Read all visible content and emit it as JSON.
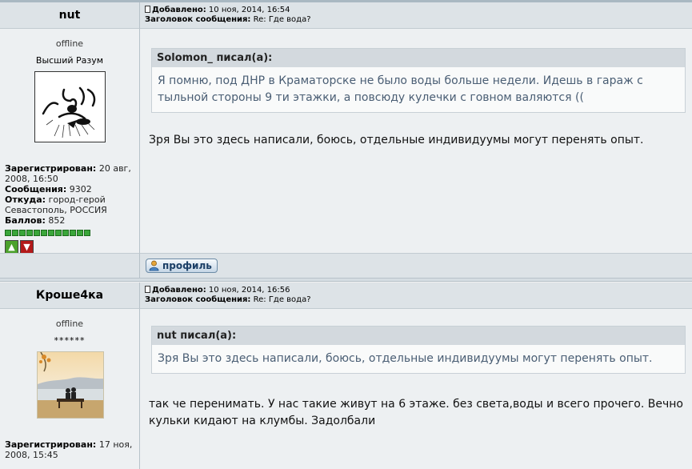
{
  "posts": [
    {
      "author": "nut",
      "status": "offline",
      "rank": "Высший Разум",
      "posted_label": "Добавлено:",
      "posted_at": "10 ноя, 2014, 16:54",
      "subject_label": "Заголовок сообщения:",
      "subject": "Re: Где вода?",
      "registered_label": "Зарегистрирован:",
      "registered": "20 авг, 2008, 16:50",
      "messages_label": "Сообщения:",
      "messages": "9302",
      "from_label": "Откуда:",
      "from": "город-герой Севастополь, РОССИЯ",
      "points_label": "Баллов:",
      "points": "852",
      "quote_author": "Solomon_ писал(а):",
      "quote_text": "Я помню, под ДНР в Краматорске не было воды больше недели. Идешь в гараж с тыльной стороны 9 ти этажки, а повсюду кулечки с говном валяются ((",
      "message": "Зря Вы это здесь написали, боюсь, отдельные индивидуумы могут перенять опыт.",
      "profile_button": "профиль"
    },
    {
      "author": "Кроше4ка",
      "status": "offline",
      "rank": "******",
      "posted_label": "Добавлено:",
      "posted_at": "10 ноя, 2014, 16:56",
      "subject_label": "Заголовок сообщения:",
      "subject": "Re: Где вода?",
      "registered_label": "Зарегистрирован:",
      "registered": "17 ноя, 2008, 15:45",
      "quote_author": "nut писал(а):",
      "quote_text": "Зря Вы это здесь написали, боюсь, отдельные индивидуумы могут перенять опыт.",
      "message": "так че перенимать. У нас такие живут на 6 этаже. без света,воды и всего прочего. Вечно кульки кидают на клумбы. Задолбали"
    }
  ],
  "colors": {
    "header_bg": "#dde3e7",
    "body_bg": "#edf0f2",
    "quote_text": "#4a5e74",
    "rating_green": "#3aa63a"
  }
}
